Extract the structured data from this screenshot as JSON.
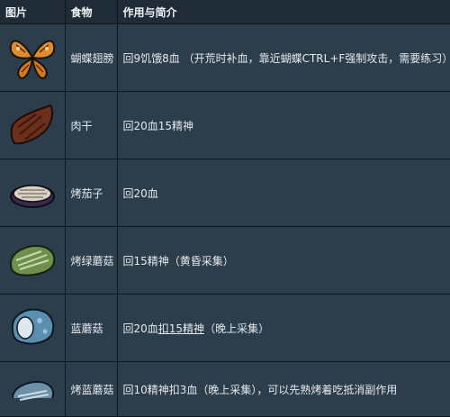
{
  "headers": [
    "图片",
    "食物",
    "作用与简介"
  ],
  "rows": [
    {
      "icon": "butterfly-wings-icon",
      "name": "蝴蝶翅膀",
      "desc": "回9饥饿8血 （开荒时补血，靠近蝴蝶CTRL+F强制攻击，需要练习）"
    },
    {
      "icon": "jerky-icon",
      "name": "肉干",
      "desc": "回20血15精神"
    },
    {
      "icon": "grilled-eggplant-icon",
      "name": "烤茄子",
      "desc": "回20血"
    },
    {
      "icon": "green-mushroom-icon",
      "name": "烤绿蘑菇",
      "desc": "回15精神（黄昏采集）"
    },
    {
      "icon": "blue-mushroom-icon",
      "name": "蓝蘑菇",
      "desc_a": "回20血",
      "desc_u": "扣15精神",
      "desc_b": "（晚上采集）"
    },
    {
      "icon": "cooked-blue-mushroom-icon",
      "name": "烤蓝蘑菇",
      "desc": "回10精神扣3血（晚上采集），可以先熟烤着吃抵消副作用"
    }
  ]
}
